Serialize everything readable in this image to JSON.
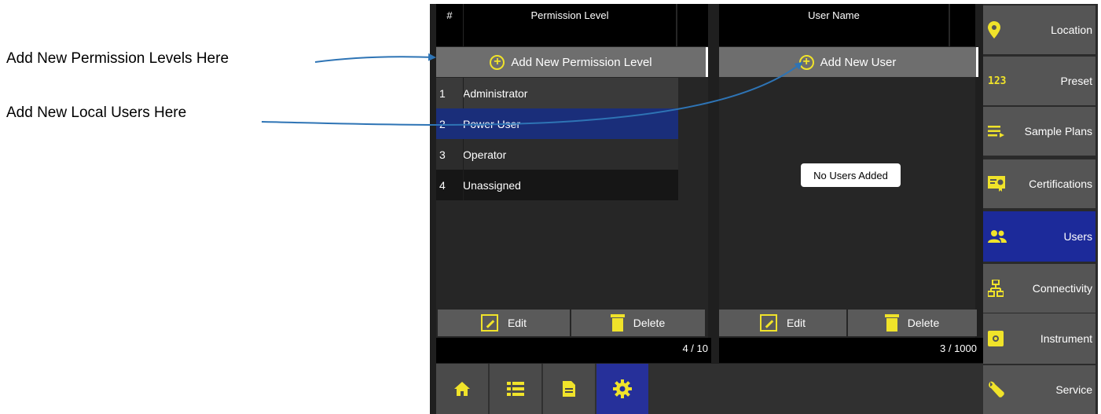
{
  "annotations": {
    "add_permission": "Add New Permission Levels Here",
    "add_users": "Add New Local Users Here"
  },
  "permission_table": {
    "col_num": "#",
    "col_level": "Permission Level",
    "add_label": "Add New Permission Level",
    "rows": [
      {
        "num": "1",
        "name": "Administrator"
      },
      {
        "num": "2",
        "name": "Power User"
      },
      {
        "num": "3",
        "name": "Operator"
      },
      {
        "num": "4",
        "name": "Unassigned"
      }
    ],
    "selected_row": "2",
    "edit_label": "Edit",
    "delete_label": "Delete",
    "count": "4 / 10"
  },
  "user_table": {
    "col_name": "User Name",
    "add_label": "Add New User",
    "empty_text": "No Users Added",
    "edit_label": "Edit",
    "delete_label": "Delete",
    "count": "3 / 1000"
  },
  "sidebar": {
    "items": [
      {
        "label": "Location",
        "icon": "location-pin-icon"
      },
      {
        "label": "Preset",
        "icon": "123-icon"
      },
      {
        "label": "Sample Plans",
        "icon": "list-arrow-icon"
      },
      {
        "label": "Certifications",
        "icon": "certificate-icon"
      },
      {
        "label": "Users",
        "icon": "users-icon"
      },
      {
        "label": "Connectivity",
        "icon": "network-icon"
      },
      {
        "label": "Instrument",
        "icon": "instrument-icon"
      },
      {
        "label": "Service",
        "icon": "wrench-icon"
      }
    ],
    "active": "Users"
  },
  "bottom_nav": {
    "items": [
      "home-icon",
      "list-icon",
      "document-icon",
      "settings-gear-icon"
    ],
    "active": "settings-gear-icon"
  },
  "colors": {
    "accent_yellow": "#f0e32a",
    "selected_blue": "#1a2e7a",
    "active_nav_blue": "#26309a",
    "arrow_blue": "#2e74b5"
  }
}
